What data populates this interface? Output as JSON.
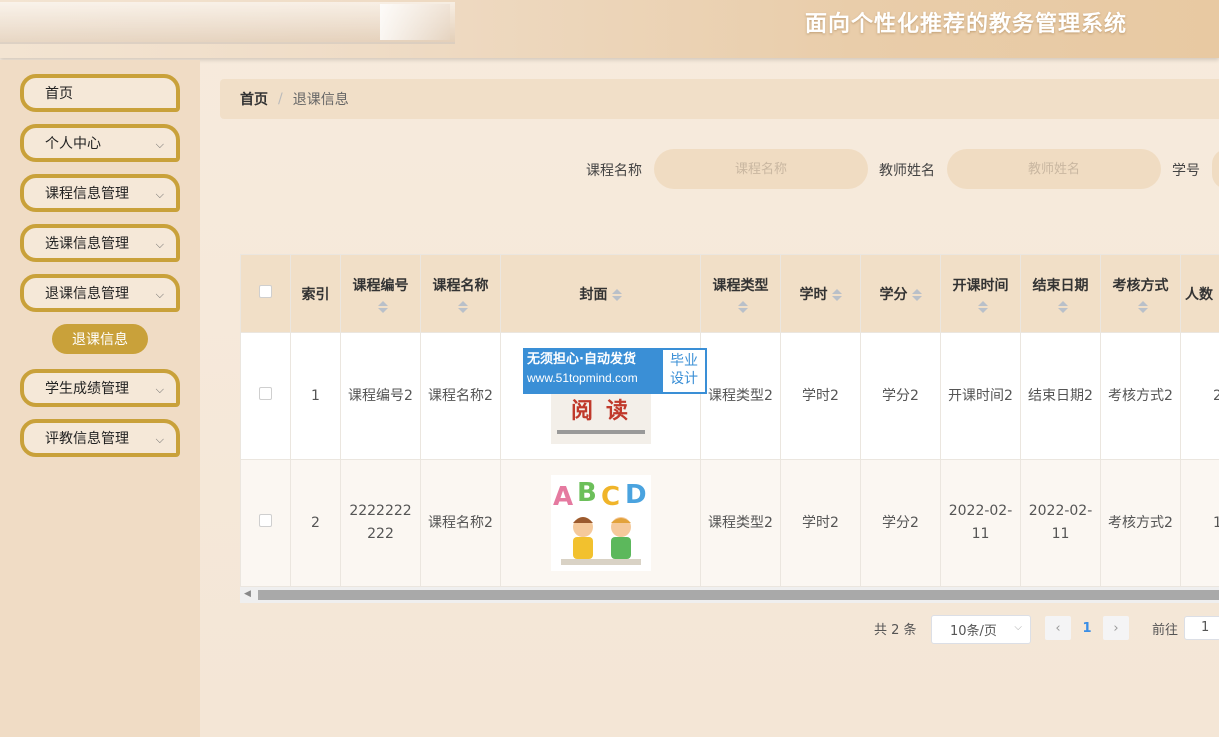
{
  "header": {
    "title": "面向个性化推荐的教务管理系统"
  },
  "sidebar": {
    "items": [
      {
        "label": "首页",
        "chevron": false
      },
      {
        "label": "个人中心",
        "chevron": true
      },
      {
        "label": "课程信息管理",
        "chevron": true
      },
      {
        "label": "选课信息管理",
        "chevron": true
      },
      {
        "label": "退课信息管理",
        "chevron": true
      },
      {
        "label": "学生成绩管理",
        "chevron": true
      },
      {
        "label": "评教信息管理",
        "chevron": true
      }
    ],
    "sub_item": {
      "label": "退课信息"
    },
    "chevron_glyph": "⌵"
  },
  "breadcrumb": {
    "home": "首页",
    "separator": "/",
    "current": "退课信息"
  },
  "search": {
    "course_name_label": "课程名称",
    "course_name_placeholder": "课程名称",
    "teacher_name_label": "教师姓名",
    "teacher_name_placeholder": "教师姓名",
    "student_id_label": "学号"
  },
  "table": {
    "columns": {
      "index": "索引",
      "course_code": "课程编号",
      "course_name": "课程名称",
      "cover": "封面",
      "course_type": "课程类型",
      "hours": "学时",
      "credits": "学分",
      "start_time": "开课时间",
      "end_date": "结束日期",
      "exam_method": "考核方式",
      "people": "人数"
    },
    "rows": [
      {
        "index": "1",
        "course_code": "课程编号2",
        "course_name": "课程名称2",
        "cover_line1": "无须担心·自动发货",
        "cover_line2": "www.51topmind.com",
        "cover_badge_top": "毕业",
        "cover_badge_bottom": "设计",
        "course_type": "课程类型2",
        "hours": "学时2",
        "credits": "学分2",
        "start_time": "开课时间2",
        "end_date": "结束日期2",
        "exam_method": "考核方式2",
        "people": "2"
      },
      {
        "index": "2",
        "course_code": "2222222222",
        "course_name": "课程名称2",
        "cover_letters": [
          "A",
          "B",
          "C",
          "D"
        ],
        "course_type": "课程类型2",
        "hours": "学时2",
        "credits": "学分2",
        "start_time": "2022-02-11",
        "end_date": "2022-02-11",
        "exam_method": "考核方式2",
        "people": "1"
      }
    ]
  },
  "pagination": {
    "total": "共 2 条",
    "page_size": "10条/页",
    "prev": "‹",
    "current_page": "1",
    "next": "›",
    "goto_label": "前往",
    "goto_value": "1"
  },
  "colors": {
    "accent": "#c9a13a",
    "header_bg": "#f1dfc7",
    "link": "#3a8ee6"
  }
}
